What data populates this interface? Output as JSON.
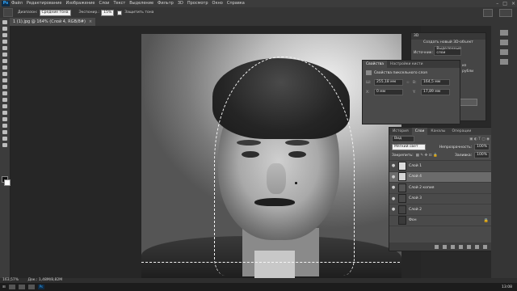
{
  "app": {
    "logo": "Ps"
  },
  "menu": [
    "Файл",
    "Редактирование",
    "Изображение",
    "Слои",
    "Текст",
    "Выделение",
    "Фильтр",
    "3D",
    "Просмотр",
    "Окно",
    "Справка"
  ],
  "window_controls": [
    "–",
    "□",
    "×"
  ],
  "options_bar": {
    "mode_label": "Диапазон:",
    "mode_value": "Средние тона",
    "exposure_label": "Экспонир.:",
    "exposure_value": "15%",
    "protect_tones_label": "Защитить тона"
  },
  "document_tab": {
    "title": "1 (1).jpg @ 164% (Слой 4, RGB/8#)",
    "close": "×"
  },
  "panel_3d": {
    "tab": "3D",
    "title": "Создать новый 3D-объект",
    "source_label": "Источник:",
    "source_value": "Выделенные слои",
    "field_a": "из",
    "field_b": "рубли",
    "create_label": "Создать"
  },
  "properties_panel": {
    "tabs": [
      "Свойства",
      "Настройки кисти"
    ],
    "header": "Свойства пиксельного слоя",
    "w_label": "Ш:",
    "w_value": "255,18 мм",
    "h_label": "В:",
    "h_value": "164,5 мм",
    "x_label": "X:",
    "x_value": "0 мм",
    "y_label": "Y:",
    "y_value": "17,89 мм"
  },
  "layers_panel": {
    "tabs": [
      "История",
      "Слои",
      "Каналы",
      "Операции"
    ],
    "active_tab": "Слои",
    "filter_label": "Вид",
    "blend_mode": "Мягкий свет",
    "opacity_label": "Непрозрачность:",
    "opacity_value": "100%",
    "lock_label": "Закрепить:",
    "fill_label": "Заливка:",
    "fill_value": "100%",
    "layers": [
      {
        "name": "Слой 1",
        "selected": false,
        "thumb": "#dcdcdc",
        "visible": true
      },
      {
        "name": "Слой 4",
        "selected": true,
        "thumb": "#d4d4d4",
        "visible": true
      },
      {
        "name": "Слой 2 копия",
        "selected": false,
        "thumb": "#555555",
        "visible": true
      },
      {
        "name": "Слой 3",
        "selected": false,
        "thumb": "#4a4a4a",
        "visible": true
      },
      {
        "name": "Слой 2",
        "selected": false,
        "thumb": "#444444",
        "visible": true
      },
      {
        "name": "Фон",
        "selected": false,
        "thumb": "#3a3a3a",
        "visible": false,
        "locked": true
      }
    ]
  },
  "status_bar": {
    "zoom": "163,57%",
    "doc": "Док.: 1,48M/8,82M"
  },
  "taskbar": {
    "start": "⊞",
    "ps_icon": "Ps",
    "clock": "13:08"
  }
}
